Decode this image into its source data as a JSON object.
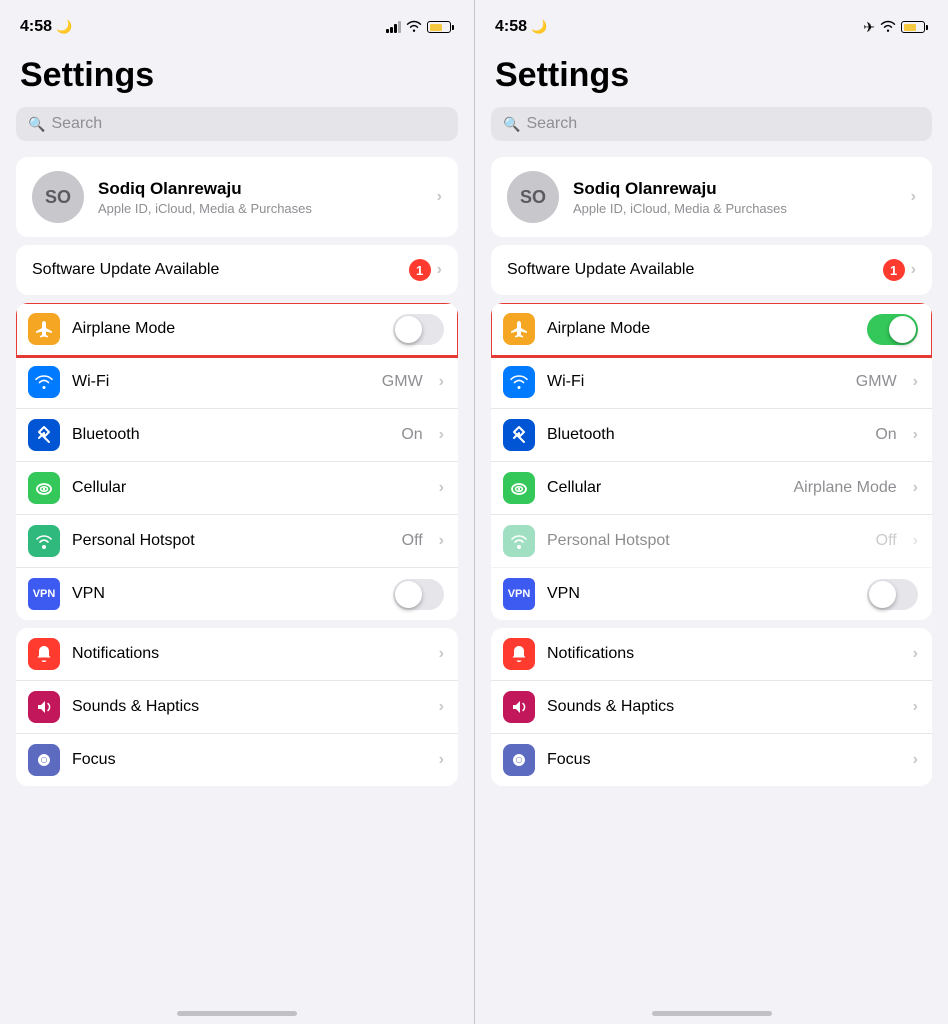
{
  "panel_left": {
    "status": {
      "time": "4:58",
      "moon": "🌙",
      "signal": true,
      "wifi": true,
      "battery_color": "#f5c842",
      "airplane_mode": false
    },
    "title": "Settings",
    "search_placeholder": "Search",
    "profile": {
      "initials": "SO",
      "name": "Sodiq Olanrewaju",
      "sub": "Apple ID, iCloud, Media & Purchases"
    },
    "software_update": "Software Update Available",
    "badge": "1",
    "airplane_mode_label": "Airplane Mode",
    "airplane_mode_on": false,
    "rows": [
      {
        "icon_class": "icon-blue",
        "icon": "📶",
        "label": "Wi-Fi",
        "value": "GMW"
      },
      {
        "icon_class": "icon-blue-dark",
        "icon": "✦",
        "label": "Bluetooth",
        "value": "On"
      },
      {
        "icon_class": "icon-green",
        "icon": "((·))",
        "label": "Cellular",
        "value": ""
      },
      {
        "icon_class": "icon-green-teal",
        "icon": "⊕",
        "label": "Personal Hotspot",
        "value": "Off"
      },
      {
        "icon_class": "icon-vpn",
        "icon": "VPN",
        "label": "VPN",
        "value": "",
        "toggle": true,
        "toggle_on": false
      }
    ],
    "rows2": [
      {
        "icon_class": "icon-red",
        "icon": "🔔",
        "label": "Notifications",
        "value": ""
      },
      {
        "icon_class": "icon-pink",
        "icon": "♪",
        "label": "Sounds & Haptics",
        "value": ""
      },
      {
        "icon_class": "icon-purple",
        "icon": "🌙",
        "label": "Focus",
        "value": ""
      }
    ]
  },
  "panel_right": {
    "status": {
      "time": "4:58",
      "moon": "🌙",
      "airplane": true,
      "wifi": true,
      "battery_color": "#f5c842",
      "airplane_mode": true
    },
    "title": "Settings",
    "search_placeholder": "Search",
    "profile": {
      "initials": "SO",
      "name": "Sodiq Olanrewaju",
      "sub": "Apple ID, iCloud, Media & Purchases"
    },
    "software_update": "Software Update Available",
    "badge": "1",
    "airplane_mode_label": "Airplane Mode",
    "airplane_mode_on": true,
    "rows": [
      {
        "icon_class": "icon-blue",
        "icon": "📶",
        "label": "Wi-Fi",
        "value": "GMW"
      },
      {
        "icon_class": "icon-blue-dark",
        "icon": "✦",
        "label": "Bluetooth",
        "value": "On"
      },
      {
        "icon_class": "icon-green",
        "icon": "((·))",
        "label": "Cellular",
        "value": "Airplane Mode",
        "dimmed": false
      },
      {
        "icon_class": "icon-green-teal",
        "icon": "⊕",
        "label": "Personal Hotspot",
        "value": "Off",
        "dimmed": true
      },
      {
        "icon_class": "icon-vpn",
        "icon": "VPN",
        "label": "VPN",
        "value": "",
        "toggle": true,
        "toggle_on": false
      }
    ],
    "rows2": [
      {
        "icon_class": "icon-red",
        "icon": "🔔",
        "label": "Notifications",
        "value": ""
      },
      {
        "icon_class": "icon-pink",
        "icon": "♪",
        "label": "Sounds & Haptics",
        "value": ""
      },
      {
        "icon_class": "icon-purple",
        "icon": "🌙",
        "label": "Focus",
        "value": ""
      }
    ]
  }
}
